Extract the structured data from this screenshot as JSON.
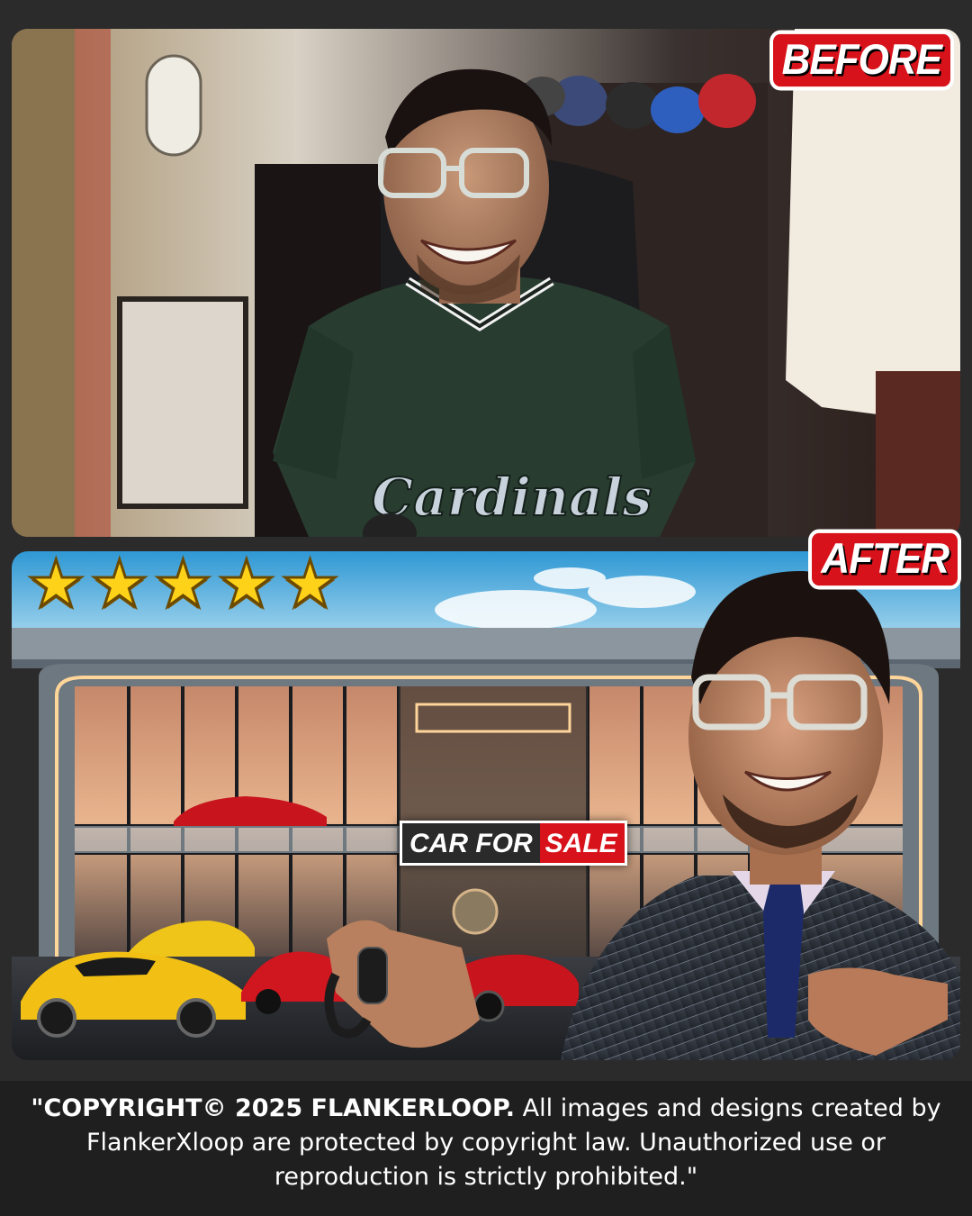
{
  "labels": {
    "before": "BEFORE",
    "after": "AFTER"
  },
  "rating": {
    "stars": 5,
    "star_glyph": "★",
    "star_color": "#ffd21a"
  },
  "sign": {
    "part1": "CAR FOR",
    "part2": "SALE"
  },
  "footer": {
    "copyright_bold": "\"COPYRIGHT© 2025 FLANKERLOOP.",
    "copyright_rest": " All images and designs created by FlankerXloop are protected by copyright law. Unauthorized use or reproduction is strictly prohibited.\""
  },
  "shirt_text": "Cardinals",
  "colors": {
    "accent_red": "#d8121a",
    "background": "#2b2b2b",
    "footer_bg": "#1f1f1f"
  }
}
